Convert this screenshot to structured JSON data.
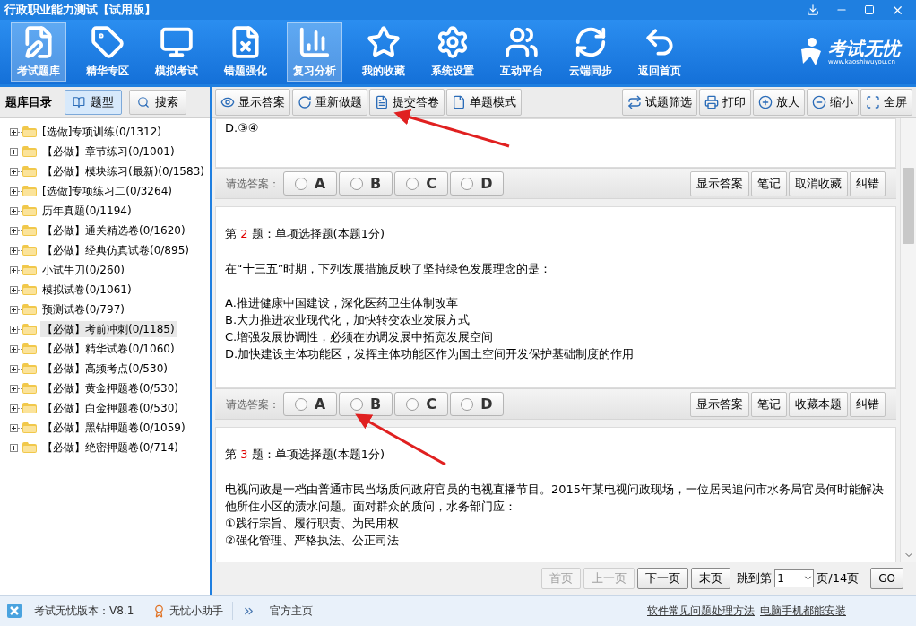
{
  "window": {
    "title": "行政职业能力测试【试用版】"
  },
  "toolbar": [
    {
      "label": "考试题库",
      "selected": true
    },
    {
      "label": "精华专区",
      "selected": false
    },
    {
      "label": "模拟考试",
      "selected": false
    },
    {
      "label": "错题强化",
      "selected": false
    },
    {
      "label": "复习分析",
      "selected": true
    },
    {
      "label": "我的收藏",
      "selected": false
    },
    {
      "label": "系统设置",
      "selected": false
    },
    {
      "label": "互动平台",
      "selected": false
    },
    {
      "label": "云端同步",
      "selected": false
    },
    {
      "label": "返回首页",
      "selected": false
    }
  ],
  "logo": {
    "name": "考试无忧",
    "url": "www.kaoshiwuyou.cn"
  },
  "sidebar": {
    "title": "题库目录",
    "tabs": [
      {
        "label": "题型",
        "selected": true
      },
      {
        "label": "搜索",
        "selected": false
      }
    ],
    "items": [
      {
        "label": "[选做]专项训练(0/1312)",
        "selected": false
      },
      {
        "label": "【必做】章节练习(0/1001)",
        "selected": false
      },
      {
        "label": "【必做】模块练习(最新)(0/1583)",
        "selected": false
      },
      {
        "label": "[选做]专项练习二(0/3264)",
        "selected": false
      },
      {
        "label": "历年真题(0/1194)",
        "selected": false
      },
      {
        "label": "【必做】通关精选卷(0/1620)",
        "selected": false
      },
      {
        "label": "【必做】经典仿真试卷(0/895)",
        "selected": false
      },
      {
        "label": "小试牛刀(0/260)",
        "selected": false
      },
      {
        "label": "模拟试卷(0/1061)",
        "selected": false
      },
      {
        "label": "预测试卷(0/797)",
        "selected": false
      },
      {
        "label": "【必做】考前冲刺(0/1185)",
        "selected": true
      },
      {
        "label": "【必做】精华试卷(0/1060)",
        "selected": false
      },
      {
        "label": "【必做】高频考点(0/530)",
        "selected": false
      },
      {
        "label": "【必做】黄金押题卷(0/530)",
        "selected": false
      },
      {
        "label": "【必做】白金押题卷(0/530)",
        "selected": false
      },
      {
        "label": "【必做】黑钻押题卷(0/1059)",
        "selected": false
      },
      {
        "label": "【必做】绝密押题卷(0/714)",
        "selected": false
      }
    ]
  },
  "action_bar": {
    "left": [
      "显示答案",
      "重新做题",
      "提交答卷",
      "单题模式"
    ],
    "right": [
      "试题筛选",
      "打印",
      "放大",
      "缩小",
      "全屏"
    ]
  },
  "questions": [
    {
      "lines": [
        "D.③④"
      ],
      "answer_bar": {
        "label": "请选答案：",
        "options": [
          {
            "letter": "A",
            "selected": false
          },
          {
            "letter": "B",
            "selected": false
          },
          {
            "letter": "C",
            "selected": false
          },
          {
            "letter": "D",
            "selected": false
          }
        ],
        "buttons": [
          "显示答案",
          "笔记",
          "取消收藏",
          "纠错"
        ]
      }
    },
    {
      "heading_prefix": "第",
      "number": "2",
      "heading_suffix": "题：单项选择题(本题1分)",
      "stem": "在“十三五”时期，下列发展措施反映了坚持绿色发展理念的是：",
      "lines": [
        "A.推进健康中国建设，深化医药卫生体制改革",
        "B.大力推进农业现代化，加快转变农业发展方式",
        "C.增强发展协调性，必须在协调发展中拓宽发展空间",
        "D.加快建设主体功能区，发挥主体功能区作为国土空间开发保护基础制度的作用"
      ],
      "answer_bar": {
        "label": "请选答案：",
        "options": [
          {
            "letter": "A",
            "selected": false
          },
          {
            "letter": "B",
            "selected": false
          },
          {
            "letter": "C",
            "selected": false
          },
          {
            "letter": "D",
            "selected": false
          }
        ],
        "buttons": [
          "显示答案",
          "笔记",
          "收藏本题",
          "纠错"
        ]
      }
    },
    {
      "heading_prefix": "第",
      "number": "3",
      "heading_suffix": "题：单项选择题(本题1分)",
      "stem": "电视问政是一档由普通市民当场质问政府官员的电视直播节目。2015年某电视问政现场，一位居民追问市水务局官员何时能解决他所住小区的渍水问题。面对群众的质问，水务部门应：",
      "statements": [
        "①践行宗旨、履行职责、为民用权",
        "②强化管理、严格执法、公正司法"
      ]
    }
  ],
  "pagination": {
    "buttons": [
      {
        "label": "首页",
        "disabled": true
      },
      {
        "label": "上一页",
        "disabled": true
      },
      {
        "label": "下一页",
        "disabled": false
      },
      {
        "label": "末页",
        "disabled": false
      }
    ],
    "jump_label": "跳到第",
    "page": "1",
    "total": "页/14页",
    "go": "GO"
  },
  "status_bar": {
    "version": "考试无忧版本：V8.1",
    "assistant": "无忧小助手",
    "homepage": "官方主页",
    "links": [
      "软件常见问题处理方法",
      "电脑手机都能安装"
    ]
  }
}
